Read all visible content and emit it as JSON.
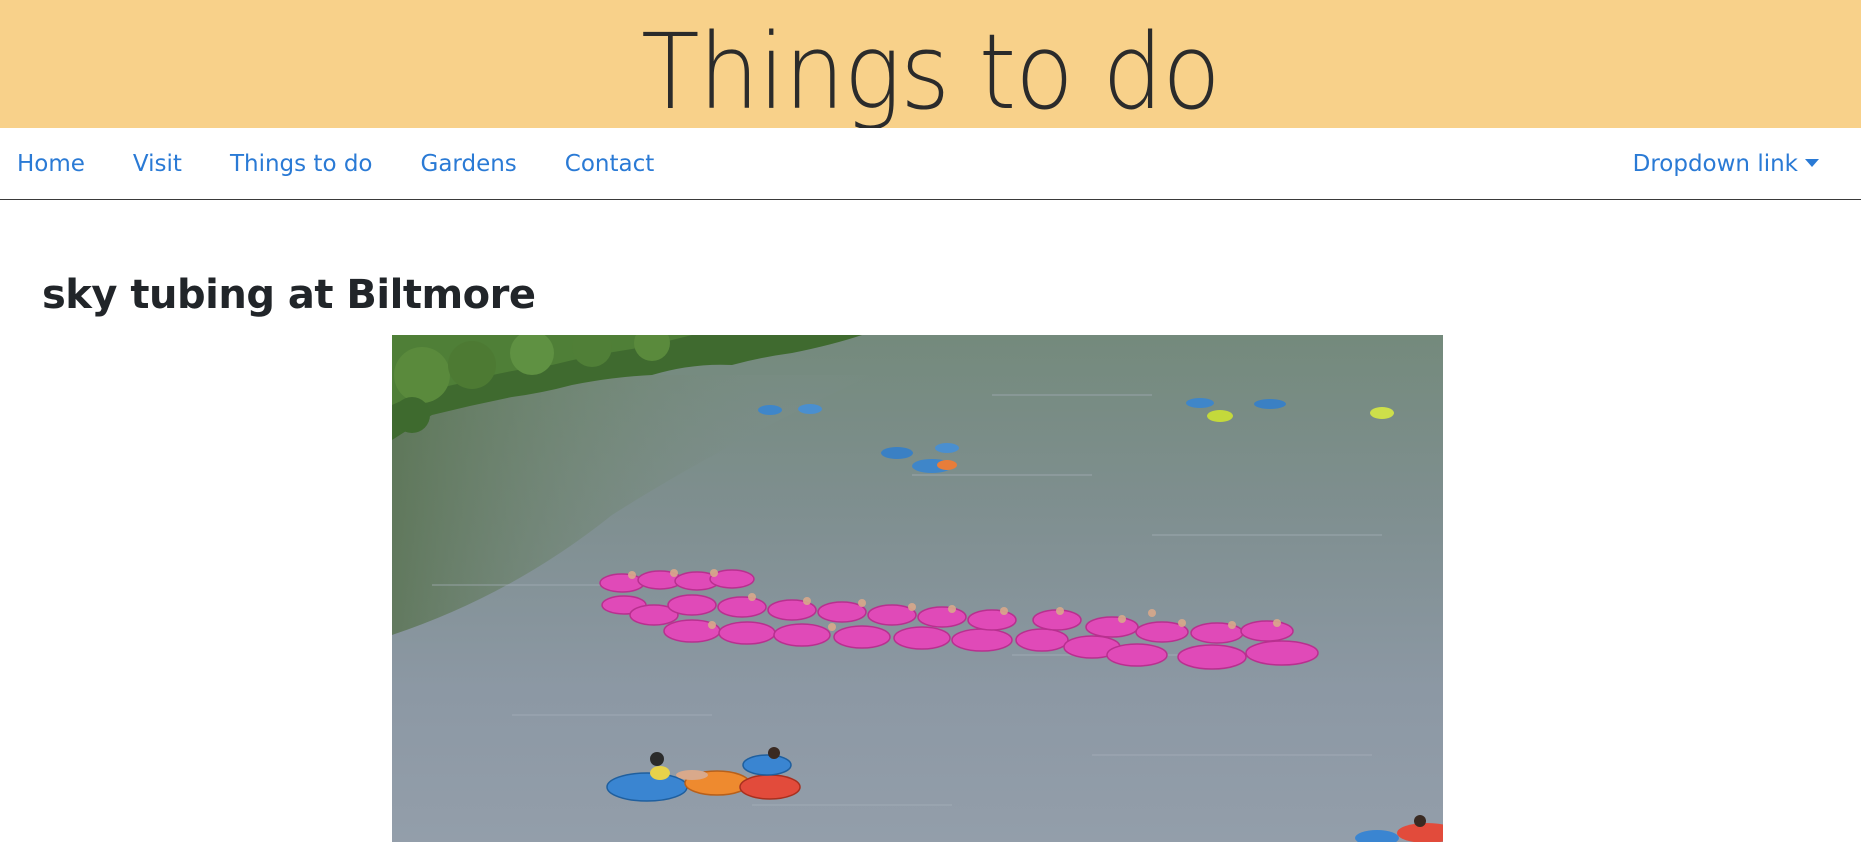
{
  "header": {
    "title": "Things to do"
  },
  "nav": {
    "items": [
      {
        "label": "Home"
      },
      {
        "label": "Visit"
      },
      {
        "label": "Things to do"
      },
      {
        "label": "Gardens"
      },
      {
        "label": "Contact"
      }
    ],
    "dropdown": {
      "label": "Dropdown link",
      "icon": "caret-down-icon"
    }
  },
  "main": {
    "heading": "sky tubing at Biltmore",
    "photo": {
      "subject": "river-tubing-photo"
    }
  },
  "colors": {
    "banner": "#f8d18a",
    "link": "#2a7ad5",
    "text": "#212529"
  }
}
